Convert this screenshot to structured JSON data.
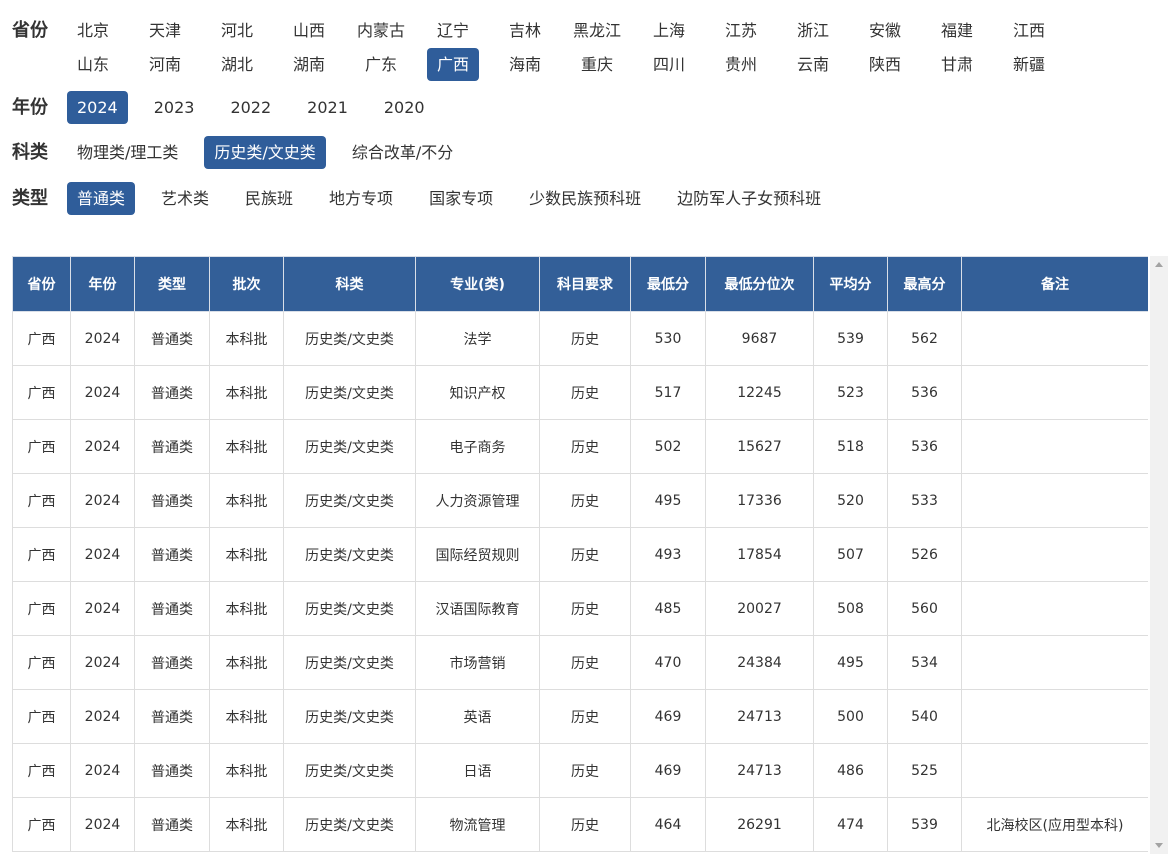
{
  "filters": {
    "province": {
      "label": "省份",
      "options": [
        "北京",
        "天津",
        "河北",
        "山西",
        "内蒙古",
        "辽宁",
        "吉林",
        "黑龙江",
        "上海",
        "江苏",
        "浙江",
        "安徽",
        "福建",
        "江西",
        "山东",
        "河南",
        "湖北",
        "湖南",
        "广东",
        "广西",
        "海南",
        "重庆",
        "四川",
        "贵州",
        "云南",
        "陕西",
        "甘肃",
        "新疆"
      ],
      "selected": "广西"
    },
    "year": {
      "label": "年份",
      "options": [
        "2024",
        "2023",
        "2022",
        "2021",
        "2020"
      ],
      "selected": "2024"
    },
    "subject": {
      "label": "科类",
      "options": [
        "物理类/理工类",
        "历史类/文史类",
        "综合改革/不分"
      ],
      "selected": "历史类/文史类"
    },
    "type": {
      "label": "类型",
      "options": [
        "普通类",
        "艺术类",
        "民族班",
        "地方专项",
        "国家专项",
        "少数民族预科班",
        "边防军人子女预科班"
      ],
      "selected": "普通类"
    }
  },
  "table": {
    "columns": [
      "省份",
      "年份",
      "类型",
      "批次",
      "科类",
      "专业(类)",
      "科目要求",
      "最低分",
      "最低分位次",
      "平均分",
      "最高分",
      "备注"
    ],
    "rows": [
      [
        "广西",
        "2024",
        "普通类",
        "本科批",
        "历史类/文史类",
        "法学",
        "历史",
        "530",
        "9687",
        "539",
        "562",
        ""
      ],
      [
        "广西",
        "2024",
        "普通类",
        "本科批",
        "历史类/文史类",
        "知识产权",
        "历史",
        "517",
        "12245",
        "523",
        "536",
        ""
      ],
      [
        "广西",
        "2024",
        "普通类",
        "本科批",
        "历史类/文史类",
        "电子商务",
        "历史",
        "502",
        "15627",
        "518",
        "536",
        ""
      ],
      [
        "广西",
        "2024",
        "普通类",
        "本科批",
        "历史类/文史类",
        "人力资源管理",
        "历史",
        "495",
        "17336",
        "520",
        "533",
        ""
      ],
      [
        "广西",
        "2024",
        "普通类",
        "本科批",
        "历史类/文史类",
        "国际经贸规则",
        "历史",
        "493",
        "17854",
        "507",
        "526",
        ""
      ],
      [
        "广西",
        "2024",
        "普通类",
        "本科批",
        "历史类/文史类",
        "汉语国际教育",
        "历史",
        "485",
        "20027",
        "508",
        "560",
        ""
      ],
      [
        "广西",
        "2024",
        "普通类",
        "本科批",
        "历史类/文史类",
        "市场营销",
        "历史",
        "470",
        "24384",
        "495",
        "534",
        ""
      ],
      [
        "广西",
        "2024",
        "普通类",
        "本科批",
        "历史类/文史类",
        "英语",
        "历史",
        "469",
        "24713",
        "500",
        "540",
        ""
      ],
      [
        "广西",
        "2024",
        "普通类",
        "本科批",
        "历史类/文史类",
        "日语",
        "历史",
        "469",
        "24713",
        "486",
        "525",
        ""
      ],
      [
        "广西",
        "2024",
        "普通类",
        "本科批",
        "历史类/文史类",
        "物流管理",
        "历史",
        "464",
        "26291",
        "474",
        "539",
        "北海校区(应用型本科)"
      ]
    ]
  },
  "colors": {
    "accent": "#2f5d9a",
    "header_bg": "#335f98"
  }
}
